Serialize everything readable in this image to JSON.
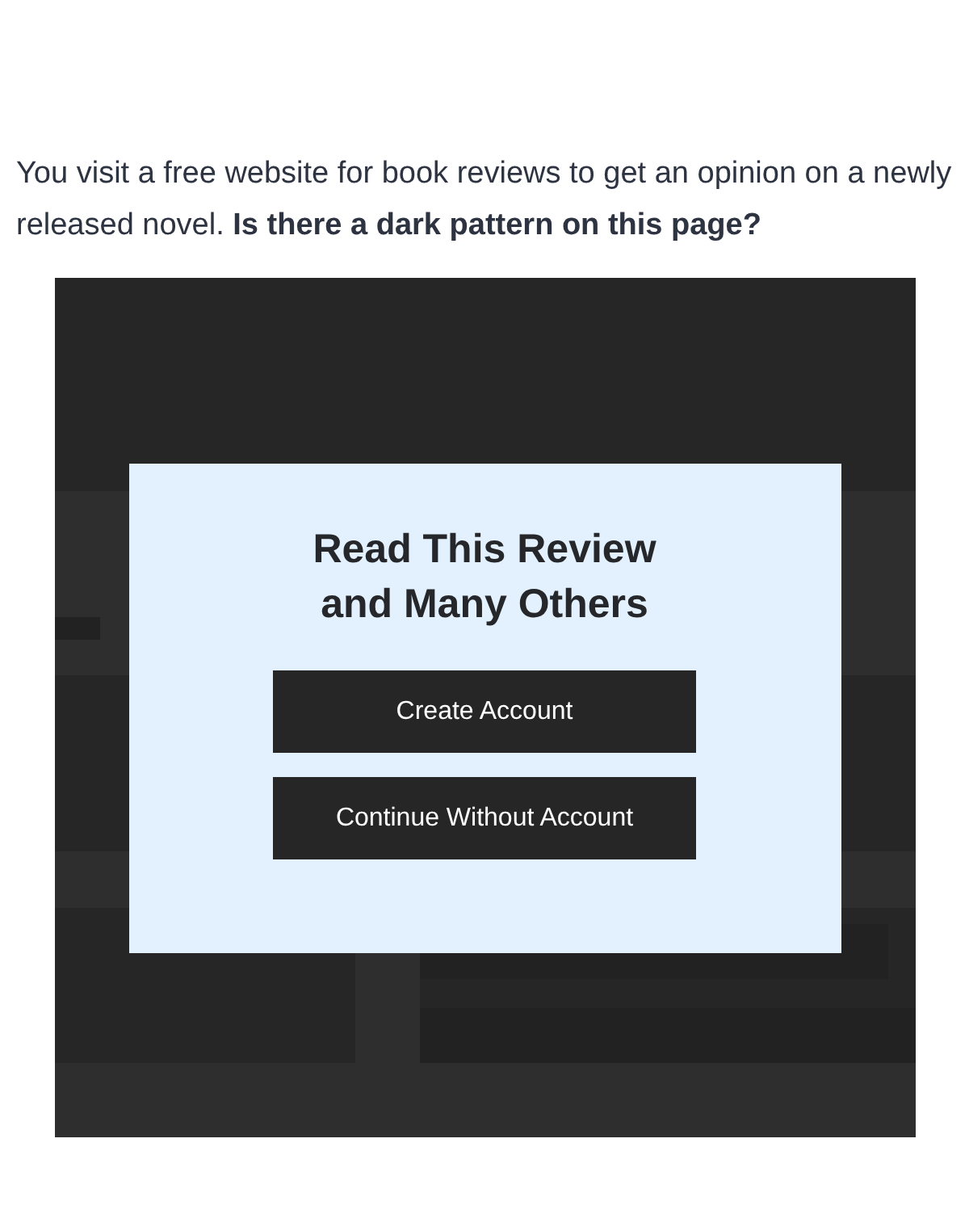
{
  "question": "You visit a free website for book reviews to get an opinion on a newly released novel. **Is there a dark pattern on this page?**",
  "modal": {
    "title": "Read This Review and Many Others",
    "buttons": [
      {
        "label": "Create Account"
      },
      {
        "label": "Continue Without Account"
      }
    ]
  }
}
